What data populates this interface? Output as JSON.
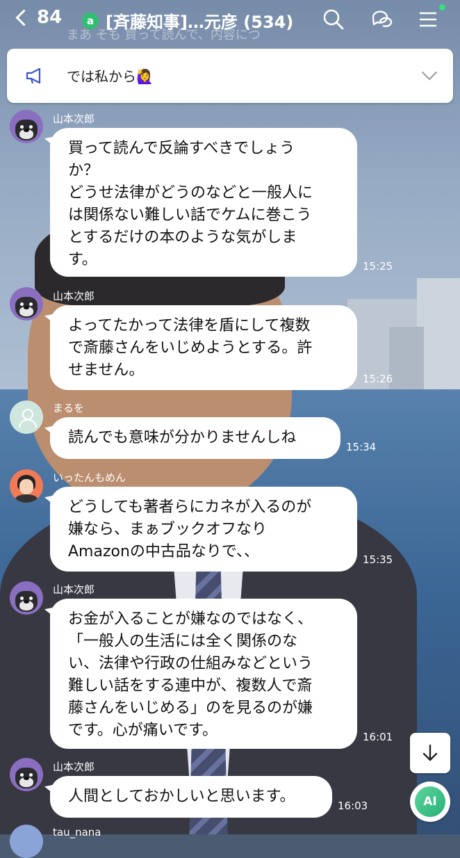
{
  "header": {
    "back_count": "84",
    "title": "[斉藤知事]…元彦 (534)",
    "background_text": "まあ そも 買って読んで、内容につ"
  },
  "announcement": {
    "text": "では私から🙋‍♀️"
  },
  "messages": [
    {
      "sender": "山本次郎",
      "lines": [
        "買って読んで反論すべきでしょう",
        "か？",
        "どうせ法律がどうのなどと一般人に",
        "は関係ない難しい話でケムに巻こう",
        "とするだけの本のような気がしま",
        "す。"
      ],
      "time": "15:25"
    },
    {
      "sender": "山本次郎",
      "lines": [
        "よってたかって法律を盾にして複数",
        "で斎藤さんをいじめようとする。許",
        "せません。"
      ],
      "time": "15:26"
    },
    {
      "sender": "まるを",
      "lines": [
        "読んでも意味が分かりませんしね"
      ],
      "time": "15:34"
    },
    {
      "sender": "いったんもめん",
      "lines": [
        "どうしても著者らにカネが入るのが",
        "嫌なら、まぁブックオフなり",
        "Amazonの中古品なりで、、"
      ],
      "time": "15:35"
    },
    {
      "sender": "山本次郎",
      "lines": [
        "お金が入ることが嫌なのではなく、",
        "「一般人の生活には全く関係のな",
        "い、法律や行政の仕組みなどという",
        "難しい話をする連中が、複数人で斎",
        "藤さんをいじめる」のを見るのが嫌",
        "です。心が痛いです。"
      ],
      "time": "16:01"
    },
    {
      "sender": "山本次郎",
      "lines": [
        "人間としておかしいと思います。"
      ],
      "time": "16:03"
    }
  ],
  "next_sender_partial": "tau_nana",
  "ai_button_label": "AI",
  "colors": {
    "open_chat_badge": "#2fbf71",
    "bubble_bg": "#ffffff",
    "online_dot": "#3ddc84"
  }
}
